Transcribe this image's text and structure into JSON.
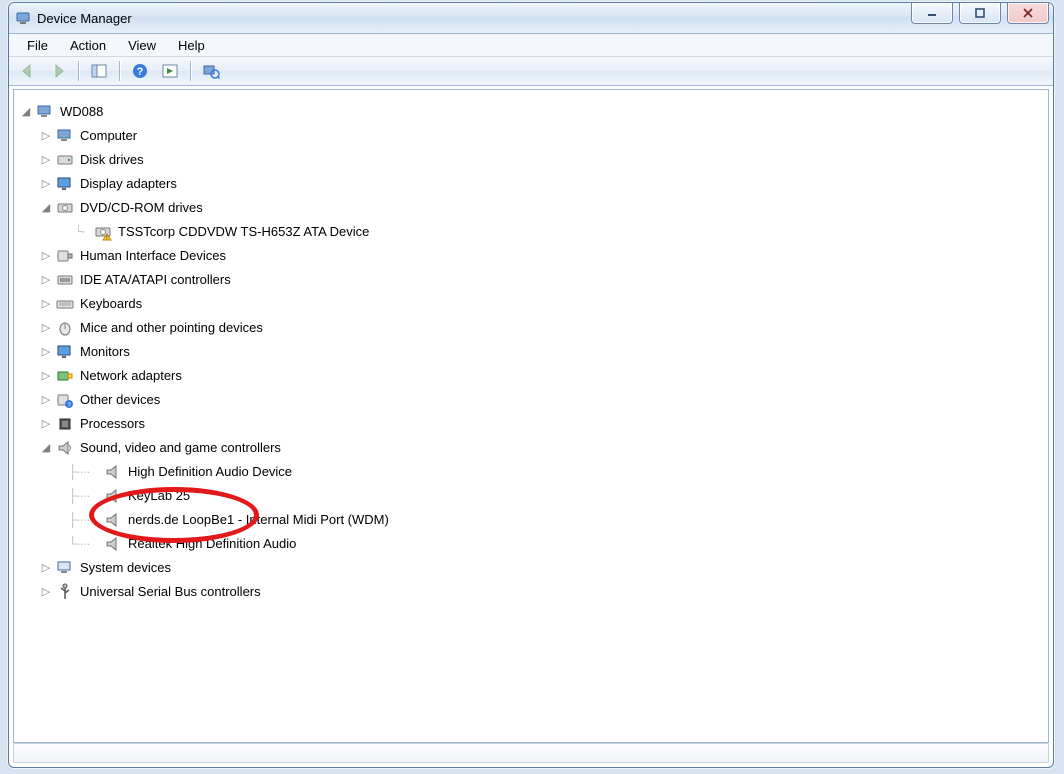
{
  "window": {
    "title": "Device Manager"
  },
  "menu": {
    "file": "File",
    "action": "Action",
    "view": "View",
    "help": "Help"
  },
  "toolbar": {
    "back": "Back",
    "forward": "Forward",
    "show_hide": "Show/Hide Console Tree",
    "help": "Help",
    "action_menu": "Action",
    "scan": "Scan for hardware changes"
  },
  "tree": {
    "root": "WD088",
    "computer": "Computer",
    "disk_drives": "Disk drives",
    "display_adapters": "Display adapters",
    "dvd_drives": "DVD/CD-ROM drives",
    "dvd_child": "TSSTcorp CDDVDW TS-H653Z ATA Device",
    "hid": "Human Interface Devices",
    "ide": "IDE ATA/ATAPI controllers",
    "keyboards": "Keyboards",
    "mice": "Mice and other pointing devices",
    "monitors": "Monitors",
    "network": "Network adapters",
    "other": "Other devices",
    "processors": "Processors",
    "sound": "Sound, video and game controllers",
    "sound_children": {
      "hd_audio": "High Definition Audio Device",
      "keylab": "KeyLab 25",
      "loopbe": "nerds.de LoopBe1 - Internal Midi Port (WDM)",
      "realtek": "Realtek High Definition Audio"
    },
    "system": "System devices",
    "usb": "Universal Serial Bus controllers"
  }
}
